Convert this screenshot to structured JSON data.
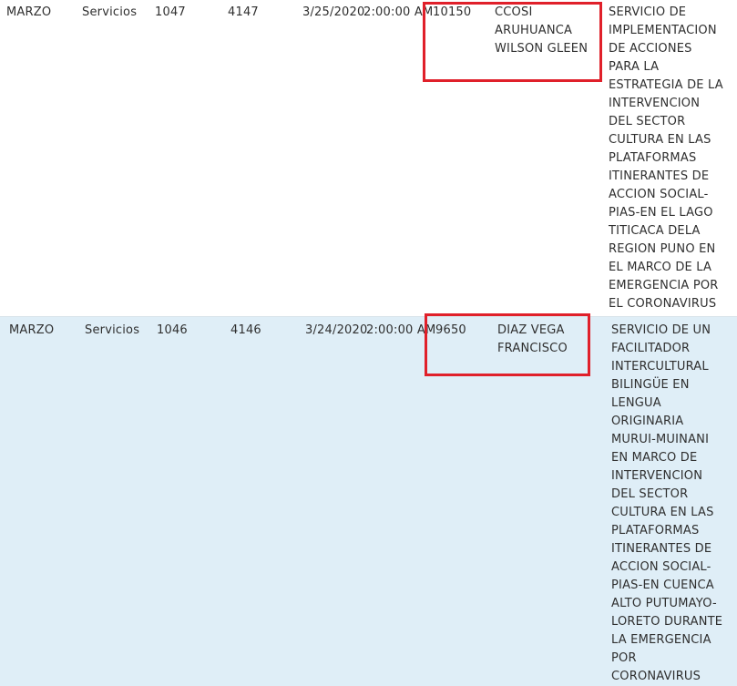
{
  "table": {
    "rows": [
      {
        "month": "MARZO",
        "type": "Servicios",
        "code_1": "1047",
        "code_2": "4147",
        "date": "3/25/2020",
        "time": "2:00:00 AM",
        "amount": "10150",
        "provider": "CCOSI\nARUHUANCA\nWILSON GLEEN",
        "description": "SERVICIO DE\nIMPLEMENTACION\nDE ACCIONES\nPARA LA\nESTRATEGIA DE LA\nINTERVENCION\nDEL SECTOR\nCULTURA EN LAS\nPLATAFORMAS\nITINERANTES DE\nACCION SOCIAL-\nPIAS-EN EL LAGO\nTITICACA DELA\nREGION PUNO EN\nEL MARCO DE LA\nEMERGENCIA POR\nEL CORONAVIRUS"
      },
      {
        "month": "MARZO",
        "type": "Servicios",
        "code_1": "1046",
        "code_2": "4146",
        "date": "3/24/2020",
        "time": "2:00:00 AM",
        "amount": "9650",
        "provider": "DIAZ VEGA\nFRANCISCO",
        "description": "SERVICIO DE UN\nFACILITADOR\nINTERCULTURAL\nBILINGÜE EN\nLENGUA\nORIGINARIA\nMURUI-MUINANI\nEN MARCO DE\nINTERVENCION\nDEL SECTOR\nCULTURA EN LAS\nPLATAFORMAS\nITINERANTES DE\nACCION SOCIAL-\nPIAS-EN CUENCA\nALTO PUTUMAYO-\nLORETO DURANTE\nLA EMERGENCIA\nPOR\nCORONAVIRUS"
      }
    ]
  },
  "colors": {
    "highlight": "#e0202a",
    "alt_row_bg": "#dfeef7",
    "text": "#2f2f2f"
  }
}
